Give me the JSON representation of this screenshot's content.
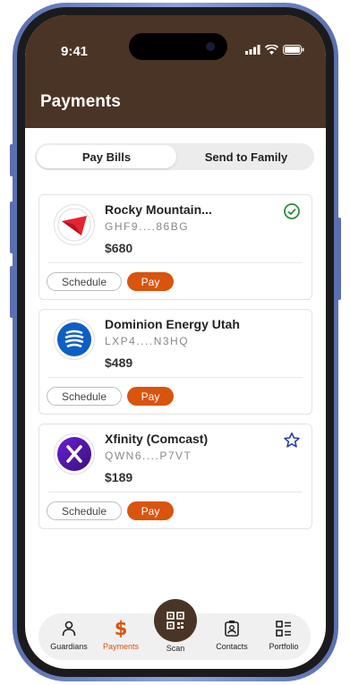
{
  "status_bar": {
    "time": "9:41"
  },
  "header": {
    "title": "Payments"
  },
  "tabs": [
    {
      "label": "Pay Bills",
      "active": true
    },
    {
      "label": "Send to Family",
      "active": false
    }
  ],
  "bills": [
    {
      "name": "Rocky Mountain...",
      "account": "GHF9....86BG",
      "amount": "$680",
      "logo": "rocky-mountain-power-logo",
      "status_icon": "check-circle-icon"
    },
    {
      "name": "Dominion Energy Utah",
      "account": "LXP4....N3HQ",
      "amount": "$489",
      "logo": "dominion-energy-logo",
      "status_icon": ""
    },
    {
      "name": "Xfinity (Comcast)",
      "account": "QWN6....P7VT",
      "amount": "$189",
      "logo": "xfinity-logo",
      "status_icon": "star-icon"
    }
  ],
  "buttons": {
    "schedule": "Schedule",
    "pay": "Pay"
  },
  "nav": [
    {
      "label": "Guardians",
      "icon": "person-icon",
      "active": false
    },
    {
      "label": "Payments",
      "icon": "dollar-icon",
      "active": true
    },
    {
      "label": "Scan",
      "icon": "qr-scan-icon",
      "active": false
    },
    {
      "label": "Contacts",
      "icon": "contacts-icon",
      "active": false
    },
    {
      "label": "Portfolio",
      "icon": "portfolio-icon",
      "active": false
    }
  ],
  "colors": {
    "header": "#4a3425",
    "accent": "#d9540d",
    "check": "#2e8b3a",
    "star": "#2342a8",
    "frame": "#6b80c0"
  }
}
